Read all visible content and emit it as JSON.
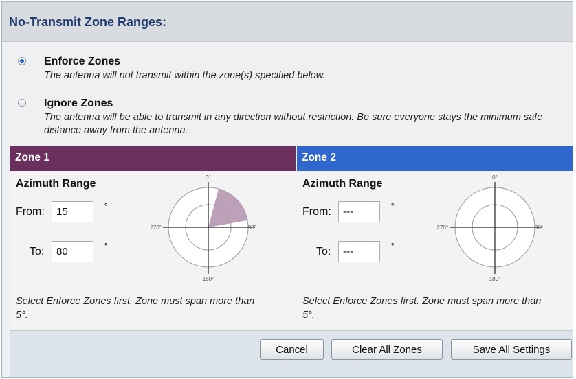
{
  "header": {
    "title": "No-Transmit Zone Ranges:"
  },
  "options": [
    {
      "title": "Enforce Zones",
      "description": "The antenna will not transmit within the zone(s) specified below.",
      "checked": true
    },
    {
      "title": "Ignore Zones",
      "description": "The antenna will be able to transmit in any direction without restriction. Be sure everyone stays the minimum safe distance away from the antenna.",
      "checked": false
    }
  ],
  "zones": [
    {
      "title": "Zone 1",
      "header_color": "#6b2f5e",
      "azimuth_title": "Azimuth Range",
      "from_label": "From:",
      "from_value": "15",
      "to_label": "To:",
      "to_value": "80",
      "degree_symbol": "°",
      "dial": {
        "top": "0°",
        "right": "90°",
        "bottom": "180°",
        "left": "270°",
        "sector_start_deg": 15,
        "sector_end_deg": 80,
        "sector_color": "#b597b0"
      },
      "note": "Select Enforce Zones first. Zone must span more than 5°."
    },
    {
      "title": "Zone 2",
      "header_color": "#2f67cf",
      "azimuth_title": "Azimuth Range",
      "from_label": "From:",
      "from_value": "---",
      "to_label": "To:",
      "to_value": "---",
      "degree_symbol": "°",
      "dial": {
        "top": "0°",
        "right": "90°",
        "bottom": "180°",
        "left": "270°"
      },
      "note": "Select Enforce Zones first. Zone must span more than 5°."
    }
  ],
  "footer": {
    "cancel_label": "Cancel",
    "clear_label": "Clear All Zones",
    "save_label": "Save All Settings"
  }
}
